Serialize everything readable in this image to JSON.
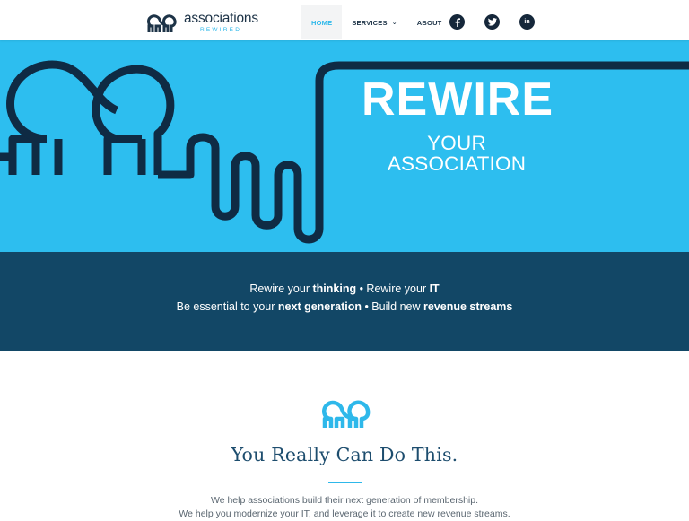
{
  "brand": {
    "name": "associations",
    "sub": "REWIRED",
    "accent_color": "#2dbeef",
    "dark_color": "#124766"
  },
  "nav": {
    "items": [
      {
        "label": "HOME",
        "active": true
      },
      {
        "label": "SERVICES",
        "has_dropdown": true
      },
      {
        "label": "ABOUT"
      }
    ],
    "social": [
      "facebook-icon",
      "twitter-icon",
      "linkedin-icon"
    ]
  },
  "hero": {
    "title": "REWIRE",
    "subtitle": "YOUR ASSOCIATION"
  },
  "band": {
    "line1": {
      "t1": "Rewire your ",
      "b1": "thinking",
      "t2": " • Rewire your ",
      "b2": "IT"
    },
    "line2": {
      "t1": "Be essential to your ",
      "b1": "next generation",
      "t2": " • Build new ",
      "b2": "revenue streams"
    }
  },
  "content": {
    "heading": "You Really Can Do This.",
    "text1": "We help associations build their next generation of membership.",
    "text2": "We help you modernize your IT, and leverage it to create new revenue streams."
  }
}
